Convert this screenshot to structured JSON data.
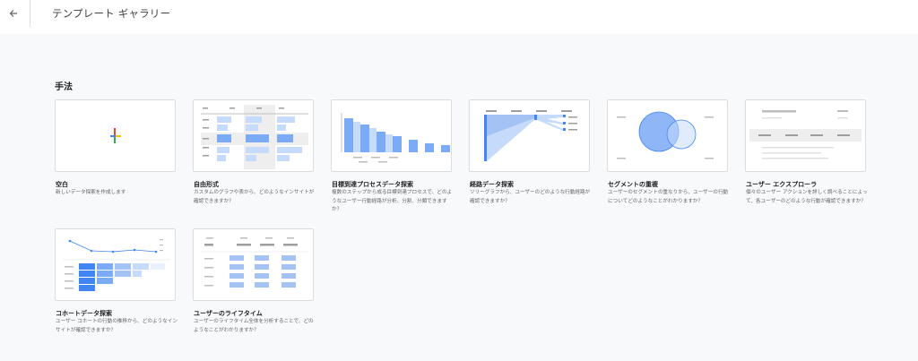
{
  "header": {
    "title": "テンプレート ギャラリー",
    "back_icon": "arrow-back-icon"
  },
  "section": {
    "title": "手法"
  },
  "templates": [
    {
      "name": "空白",
      "desc": "新しいデータ探索を作成します"
    },
    {
      "name": "自由形式",
      "desc": "カスタムのグラフや表から、どのようなインサイトが確認できますか？"
    },
    {
      "name": "目標到達プロセスデータ探索",
      "desc": "複数のステップから成る目標到達プロセスで、どのようなユーザー行動経路が分析、分割、分類できますか？"
    },
    {
      "name": "経路データ探索",
      "desc": "ツリーグラフから、ユーザーのどのような行動経路が確認できますか？"
    },
    {
      "name": "セグメントの重複",
      "desc": "ユーザーのセグメントの重なりから、ユーザーの行動についてどのようなことがわかりますか？"
    },
    {
      "name": "ユーザー エクスプローラ",
      "desc": "個々のユーザー アクションを詳しく調べることによって、各ユーザーのどのような行動が確認できますか？"
    },
    {
      "name": "コホートデータ探索",
      "desc": "ユーザー コホートの行動の推移から、どのようなインサイトが確認できますか？"
    },
    {
      "name": "ユーザーのライフタイム",
      "desc": "ユーザーのライフタイム全体を分析することで、どのようなことがわかりますか？"
    }
  ],
  "colors": {
    "accent_blue": "#7baaf7",
    "light_blue": "#c6dafc",
    "plus_red": "#ea4335",
    "plus_blue": "#4285f4",
    "plus_green": "#34a853",
    "plus_yellow": "#fbbc04"
  }
}
